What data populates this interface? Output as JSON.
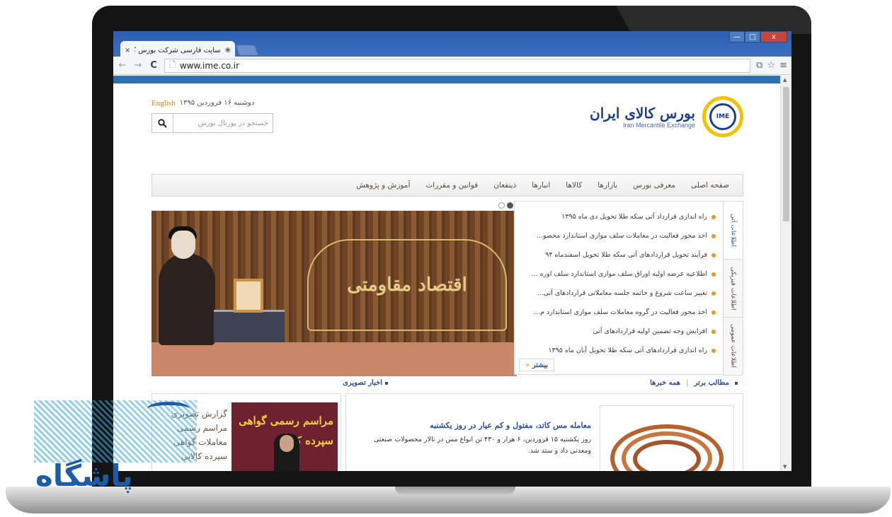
{
  "browser": {
    "tab_title": "سایت فارسی شرکت بورس کالای",
    "tab_close": "×",
    "url": "www.ime.co.ir",
    "controls": {
      "minimize": "—",
      "maximize": "□",
      "close": "x"
    }
  },
  "site": {
    "logo_badge": "IME",
    "logo_fa": "بورس کالای ایران",
    "logo_en": "Iran Mercantile Exchange",
    "date": "دوشنبه ۱۶ فروردین ۱۳۹۵",
    "english_link": "English",
    "search_placeholder": "جستجو در پورتال بورس"
  },
  "main_nav": [
    "صفحه اصلی",
    "معرفی بورس",
    "بازارها",
    "کالاها",
    "انبارها",
    "ذینفعان",
    "قوانین و مقررات",
    "آموزش و پژوهش"
  ],
  "slider": {
    "banner_text": "اقتصاد مقاومتی"
  },
  "news_panel": {
    "tabs": [
      "اطلاعات آتی",
      "اطلاعات فیزیکی",
      "اطلاعات عمومی"
    ],
    "items": [
      "راه اندازی قرارداد آتی سکه طلا تحویل دی ماه ۱۳۹۵",
      "اخذ مجوز فعالیت در معاملات سلف موازی استاندارد محصو...",
      "فرآیند تحویل قراردادهای آتی سکه طلا تحویل اسفندماه ۹۴",
      "اطلاعیه عرضه اولیه اوراق سلف موازی استاندارد سلف اوره ...",
      "تغییر ساعت شروع و خاتمه جلسه معاملاتی قراردادهای آتی...",
      "اخذ مجوز فعالیت در گروه معاملات سلف موازی استاندارد م...",
      "افزایش وجه تضمین اولیه قراردادهای آتی",
      "راه اندازی قراردادهای آتی سکه طلا تحویل آبان ماه ۱۳۹۵"
    ],
    "more_label": "بیشتر",
    "more_arrow": "«"
  },
  "sections": {
    "featured": "مطالب برتر",
    "all_news": "همه خبرها",
    "photo_news": "اخبار تصویری"
  },
  "main_news": {
    "title": "معامله مس کاتد، مفتول و کم عیار در روز یکشنبه",
    "description": "روز یکشنبه ۱۵ فروردین، ۶ هزار و ۴۳۰ تن انواع مس در تالار محصولات صنعتی ومعدنی داد و ستد شد."
  },
  "photo_news": {
    "caption": "گزارش تصویری مراسم رسمی معاملات گواهی سپرده کالایی",
    "photo_text": "مراسم رسمی گواهی سپرده کالای"
  },
  "watermark": {
    "text": "پاشگاه"
  }
}
